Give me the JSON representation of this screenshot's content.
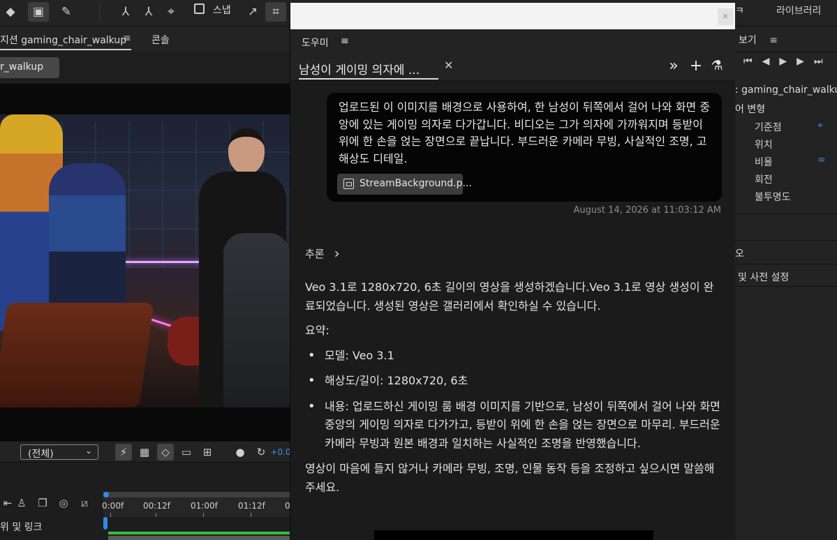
{
  "toolbar": {
    "snap_label": "스냅",
    "library_label": "라이브러리",
    "partial_label": "ㅋ"
  },
  "composition_panel": {
    "tab_label": "지션 gaming_chair_walkup",
    "console_tab": "콘솔",
    "chip_label": "r_walkup",
    "resolution_dropdown": "(전체)",
    "exposure_value": "+0.0"
  },
  "timeline": {
    "ticks": [
      "0:00f",
      "00:12f",
      "01:00f",
      "01:12f",
      "0"
    ],
    "layer_label": "위 및 링크"
  },
  "right_panel": {
    "header": "보기",
    "comp_name": ": gaming_chair_walkup.",
    "transform_label": "어 변형",
    "props": [
      "기준점",
      "위치",
      "비율",
      "회전",
      "불투명도"
    ],
    "item_a": "오",
    "item_b": "및 사전 설정"
  },
  "assistant": {
    "panel_title": "도우미",
    "tab_label": "남성이 게이밍 의자에 ...",
    "user_message": "업로드된 이 이미지를 배경으로 사용하여, 한 남성이 뒤쪽에서 걸어 나와 화면 중앙에 있는 게이밍 의자로 다가갑니다. 비디오는 그가 의자에 가까워지며 등받이 위에 한 손을 얹는 장면으로 끝납니다. 부드러운 카메라 무빙, 사실적인 조명, 고해상도 디테일.",
    "attachment_name": "StreamBackground.p...",
    "timestamp": "August 14, 2026 at 11:03:12 AM",
    "reasoning_label": "추론",
    "response_intro": "Veo 3.1로 1280x720, 6초 길이의 영상을 생성하겠습니다.Veo 3.1로 영상 생성이 완료되었습니다. 생성된 영상은 갤러리에서 확인하실 수 있습니다.",
    "summary_label": "요약:",
    "bullets": [
      "모델: Veo 3.1",
      "해상도/길이: 1280x720, 6초",
      "내용: 업로드하신 게이밍 룸 배경 이미지를 기반으로, 남성이 뒤쪽에서 걸어 나와 화면 중앙의 게이밍 의자로 다가가고, 등받이 위에 한 손을 얹는 장면으로 마무리. 부드러운 카메라 무빙과 원본 배경과 일치하는 사실적인 조명을 반영했습니다."
    ],
    "closing": "영상이 마음에 들지 않거나 카메라 무빙, 조명, 인물 동작 등을 조정하고 싶으시면 말씀해 주세요."
  }
}
